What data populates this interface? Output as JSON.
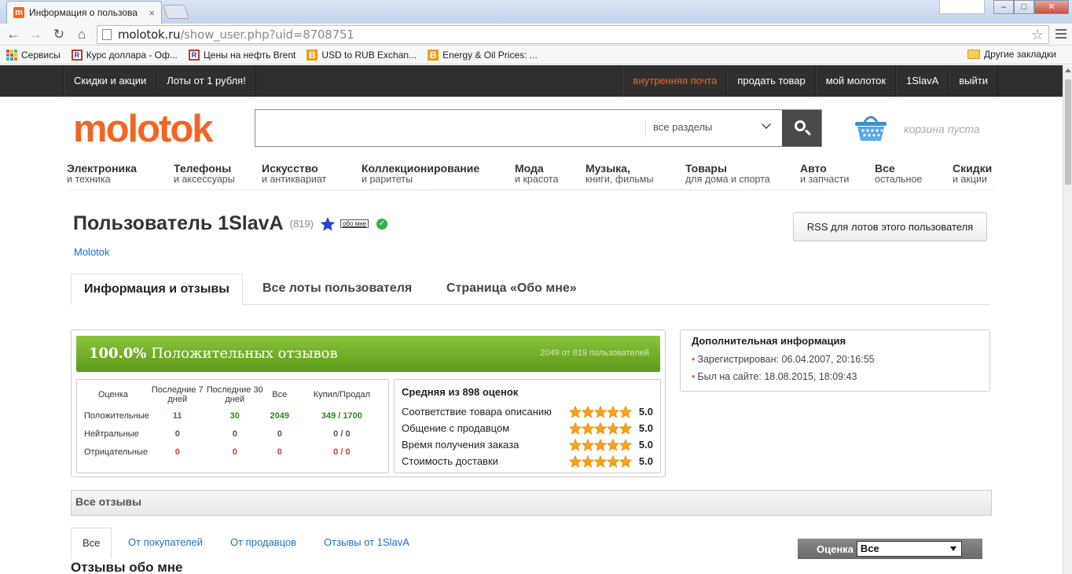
{
  "browser": {
    "tab_title": "Информация о пользова",
    "tab_close": "×",
    "favicon_letter": "m",
    "window_buttons": [
      "–",
      "□",
      "✕"
    ],
    "url_host": "molotok.ru",
    "url_path": "/show_user.php?uid=8708751",
    "bookmarks": [
      {
        "label": "Сервисы",
        "icon": "apps-grid-icon"
      },
      {
        "label": "Курс доллара - Оф...",
        "icon": "r-icon"
      },
      {
        "label": "Цены на нефть Brent",
        "icon": "r-icon"
      },
      {
        "label": "USD to RUB Exchan...",
        "icon": "b-icon"
      },
      {
        "label": "Energy & Oil Prices: ...",
        "icon": "b-icon"
      }
    ],
    "other_bookmarks": "Другие закладки"
  },
  "topnav": {
    "left": [
      "Скидки и акции",
      "Лоты от 1 рубля!"
    ],
    "right": [
      "внутренняя почта",
      "продать товар",
      "мой молоток",
      "1SlavA",
      "выйти"
    ],
    "mail_color": "#f26522"
  },
  "header": {
    "logo": "molotok",
    "search_value": "",
    "search_category": "все разделы",
    "cart_text": "корзина пуста"
  },
  "categories": [
    {
      "main": "Электроника",
      "sub": "и техника"
    },
    {
      "main": "Телефоны",
      "sub": "и аксессуары"
    },
    {
      "main": "Искусство",
      "sub": "и антиквариат"
    },
    {
      "main": "Коллекционирование",
      "sub": "и раритеты"
    },
    {
      "main": "Мода",
      "sub": "и красота"
    },
    {
      "main": "Музыка,",
      "sub": "книги, фильмы"
    },
    {
      "main": "Товары",
      "sub": "для дома и спорта"
    },
    {
      "main": "Авто",
      "sub": "и запчасти"
    },
    {
      "main": "Все",
      "sub": "остальное"
    },
    {
      "main": "Скидки",
      "sub": "и акции"
    }
  ],
  "user": {
    "title": "Пользователь 1SlavA",
    "count": "(819)",
    "about_badge": "обо мне",
    "verified": "✓",
    "breadcrumb": "Molotok",
    "rss_button": "RSS для лотов этого пользователя"
  },
  "page_tabs": [
    "Информация и отзывы",
    "Все лоты пользователя",
    "Страница «Обо мне»"
  ],
  "feedback": {
    "percent": "100.0%",
    "percent_label": "Положительных отзывов",
    "count_text": "2049 от 819 пользователей",
    "banner_color": "#6fac25",
    "table": {
      "headers": [
        "Оценка",
        "Последние 7 дней",
        "Последние 30 дней",
        "Все",
        "Купил/Продал"
      ],
      "rows": [
        {
          "label": "Положительные",
          "d7": "11",
          "d30": "30",
          "all": "2049",
          "bs": "349 / 1700",
          "tone": "green"
        },
        {
          "label": "Нейтральные",
          "d7": "0",
          "d30": "0",
          "all": "0",
          "bs": "0 / 0",
          "tone": "grey"
        },
        {
          "label": "Отрицательные",
          "d7": "0",
          "d30": "0",
          "all": "0",
          "bs": "0 / 0",
          "tone": "red"
        }
      ]
    },
    "ratings": {
      "title": "Средняя из 898 оценок",
      "items": [
        {
          "label": "Соответствие товара описанию",
          "stars": 5,
          "value": "5.0"
        },
        {
          "label": "Общение с продавцом",
          "stars": 5,
          "value": "5.0"
        },
        {
          "label": "Время получения заказа",
          "stars": 5,
          "value": "5.0"
        },
        {
          "label": "Стоимость доставки",
          "stars": 5,
          "value": "5.0"
        }
      ]
    }
  },
  "info": {
    "title": "Дополнительная информация",
    "items": [
      "Зарегистрирован: 06.04.2007, 20:16:55",
      "Был на сайте: 18.08.2015, 18:09:43"
    ]
  },
  "reviews": {
    "header": "Все отзывы",
    "tabs": [
      "Все",
      "От покупателей",
      "От продавцов",
      "Отзывы от 1SlavA"
    ],
    "filter_label": "Оценка",
    "filter_value": "Все",
    "section_title": "Отзывы обо мне"
  }
}
